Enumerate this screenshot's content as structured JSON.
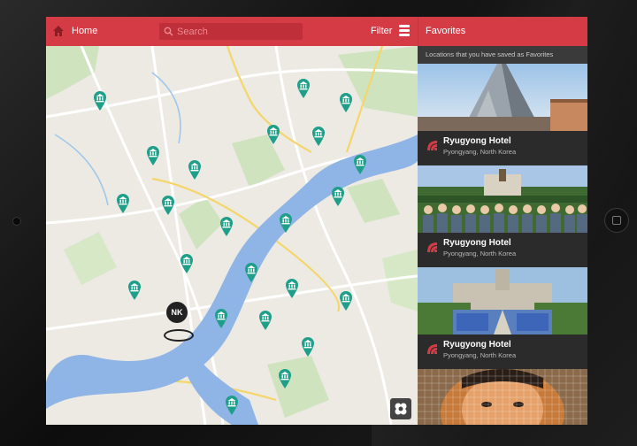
{
  "header": {
    "home_label": "Home",
    "search_placeholder": "Search",
    "filter_label": "Filter",
    "favorites_title": "Favorites"
  },
  "favorites": {
    "subtitle": "Locations that you have saved as Favorites",
    "items": [
      {
        "name": "Ryugyong Hotel",
        "location": "Pyongyang, North Korea"
      },
      {
        "name": "Ryugyong Hotel",
        "location": "Pyongyang, North Korea"
      },
      {
        "name": "Ryugyong Hotel",
        "location": "Pyongyang, North Korea"
      }
    ]
  },
  "map": {
    "marker_label": "NK",
    "pin_count": 26
  },
  "colors": {
    "accent": "#d53b45",
    "pin": "#1f9f8a",
    "panel": "#2b2b2b",
    "river": "#8fb4e6"
  },
  "icons": [
    "home-icon",
    "search-icon",
    "menu-icon",
    "museum-pin-icon",
    "location-marker-icon",
    "map-layers-icon",
    "favorite-logo-icon"
  ]
}
